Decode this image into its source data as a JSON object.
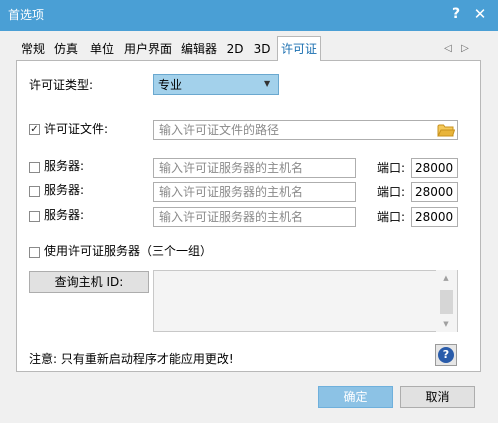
{
  "window": {
    "title": "首选项",
    "help_glyph": "?",
    "close_glyph": "✕"
  },
  "tabs": [
    {
      "label": "常规"
    },
    {
      "label": "仿真"
    },
    {
      "label": "单位"
    },
    {
      "label": "用户界面"
    },
    {
      "label": "编辑器"
    },
    {
      "label": "2D"
    },
    {
      "label": "3D"
    },
    {
      "label": "许可证",
      "active": true
    }
  ],
  "tab_nav": {
    "prev_icon": "triangle-left-icon",
    "next_icon": "triangle-right-icon",
    "prev_glyph": "◁",
    "next_glyph": "▷"
  },
  "license": {
    "type_label": "许可证类型:",
    "type_value": "专业",
    "dropdown_glyph": "▼",
    "file_checkbox_checked": true,
    "file_label": "许可证文件:",
    "file_placeholder": "输入许可证文件的路径",
    "folder_icon": "folder-icon"
  },
  "servers": [
    {
      "checked": false,
      "label": "服务器:",
      "placeholder": "输入许可证服务器的主机名",
      "port_label": "端口:",
      "port": "28000"
    },
    {
      "checked": false,
      "label": "服务器:",
      "placeholder": "输入许可证服务器的主机名",
      "port_label": "端口:",
      "port": "28000"
    },
    {
      "checked": false,
      "label": "服务器:",
      "placeholder": "输入许可证服务器的主机名",
      "port_label": "端口:",
      "port": "28000"
    }
  ],
  "use_group": {
    "checked": false,
    "label": "使用许可证服务器（三个一组）"
  },
  "query": {
    "button_label": "查询主机 ID:",
    "result": ""
  },
  "notice": "注意: 只有重新启动程序才能应用更改!",
  "help_icon": {
    "name": "help-icon",
    "glyph": "?"
  },
  "footer": {
    "ok_label": "确定",
    "cancel_label": "取消"
  },
  "colors": {
    "titlebar": "#4a9fd5",
    "active_tab_text": "#1a6fb0",
    "select_highlight": "#a3d1eb",
    "ok_button": "#8cc2e5",
    "folder": "#e8b43a"
  }
}
